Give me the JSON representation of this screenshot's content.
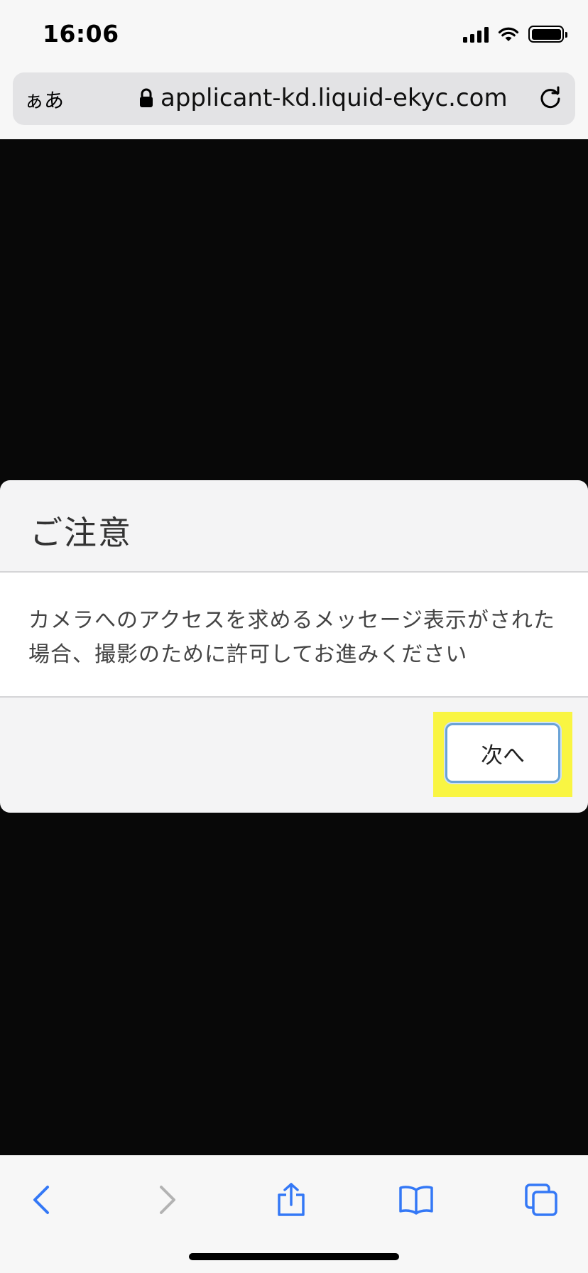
{
  "status_bar": {
    "time": "16:06",
    "icons": [
      "signal-icon",
      "wifi-icon",
      "battery-icon"
    ]
  },
  "address_bar": {
    "aa_label": "ぁあ",
    "url": "applicant-kd.liquid-ekyc.com",
    "icons": [
      "lock-icon",
      "reload-icon"
    ]
  },
  "modal": {
    "title": "ご注意",
    "message": "カメラへのアクセスを求めるメッセージ表示がされた場合、撮影のために許可してお進みください",
    "next_button_label": "次へ"
  },
  "toolbar": {
    "icons": [
      "back-icon",
      "forward-icon",
      "share-icon",
      "bookmarks-icon",
      "tabs-icon"
    ]
  },
  "colors": {
    "accent": "#3478f6",
    "disabled": "#b3b3b3",
    "highlight": "#f9f542",
    "page_background": "#080808"
  }
}
